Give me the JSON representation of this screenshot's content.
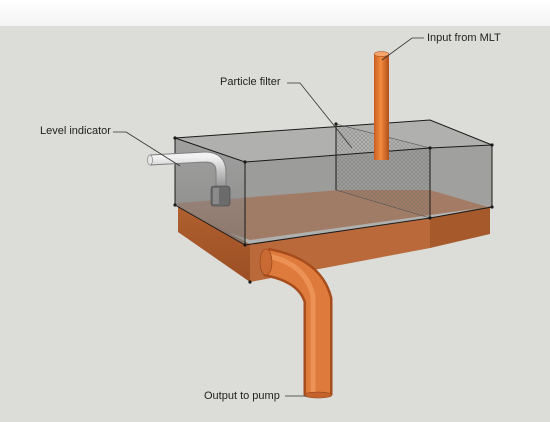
{
  "labels": {
    "input_from_mlt": "Input from MLT",
    "particle_filter": "Particle filter",
    "level_indicator": "Level indicator",
    "output_to_pump": "Output to pump"
  },
  "colors": {
    "background": "#dcdcd8",
    "copper": "#e0742c",
    "copper_dark": "#b9541c",
    "sediment": "#b8683a",
    "glass_edge": "#1a1a1a",
    "glass_fill": "#8a8a8a"
  }
}
